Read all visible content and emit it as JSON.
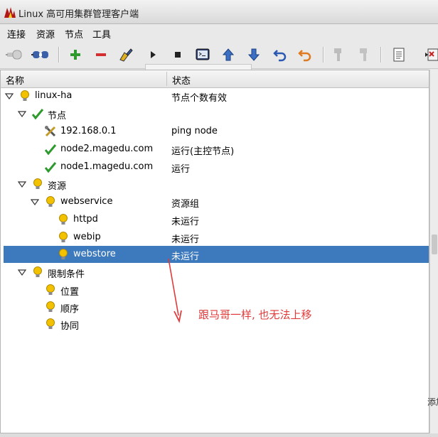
{
  "window": {
    "title": "Linux 高可用集群管理客户端"
  },
  "menubar": {
    "items": [
      "连接",
      "资源",
      "节点",
      "工具"
    ]
  },
  "toolbar": {
    "buttons": [
      "connect-icon",
      "disconnect-icon",
      "add-icon",
      "remove-icon",
      "cleanup-icon",
      "play-icon",
      "stop-icon",
      "console-icon",
      "arrow-up-icon",
      "arrow-down-icon",
      "undo-icon",
      "redo-icon",
      "standby-icon",
      "active-icon",
      "document-icon",
      "exit-icon"
    ]
  },
  "tree": {
    "columns": {
      "name": "名称",
      "status": "状态"
    },
    "rows": [
      {
        "label": "linux-ha",
        "status": "节点个数有效",
        "icon": "bulb-icon"
      },
      {
        "label": "节点",
        "status": "",
        "icon": "check-icon"
      },
      {
        "label": "192.168.0.1",
        "status": "ping node",
        "icon": "tools-icon"
      },
      {
        "label": "node2.magedu.com",
        "status": "运行(主控节点)",
        "icon": "check-icon"
      },
      {
        "label": "node1.magedu.com",
        "status": "运行",
        "icon": "check-icon"
      },
      {
        "label": "资源",
        "status": "",
        "icon": "bulb-icon"
      },
      {
        "label": "webservice",
        "status": "资源组",
        "icon": "bulb-icon"
      },
      {
        "label": "httpd",
        "status": "未运行",
        "icon": "bulb-icon"
      },
      {
        "label": "webip",
        "status": "未运行",
        "icon": "bulb-icon"
      },
      {
        "label": "webstore",
        "status": "未运行",
        "icon": "bulb-icon",
        "selected": true
      },
      {
        "label": "限制条件",
        "status": "",
        "icon": "bulb-icon"
      },
      {
        "label": "位置",
        "status": "",
        "icon": "bulb-icon"
      },
      {
        "label": "顺序",
        "status": "",
        "icon": "bulb-icon"
      },
      {
        "label": "协同",
        "status": "",
        "icon": "bulb-icon"
      }
    ]
  },
  "side_label": "添加",
  "annotation": {
    "text": "跟马哥一样, 也无法上移",
    "color": "#e03a3a"
  },
  "colors": {
    "selection": "#3d79bd",
    "check": "#2e9a2e",
    "bulb": "#f2c200"
  }
}
